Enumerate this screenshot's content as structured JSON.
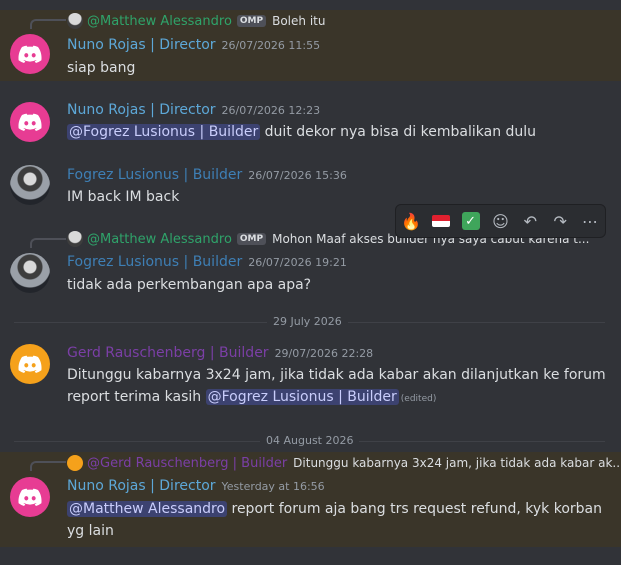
{
  "messages": [
    {
      "author": "Nuno Rojas | Director",
      "color": "#5da8d8",
      "time": "26/07/2026 11:55",
      "text": "siap bang",
      "reply": {
        "author": "@Matthew Alessandro",
        "color": "#2fa36a",
        "badge": "OMP",
        "text": "Boleh itu"
      }
    },
    {
      "author": "Nuno Rojas | Director",
      "color": "#5da8d8",
      "time": "26/07/2026 12:23",
      "mention": "@Fogrez Lusionus | Builder",
      "text": " duit dekor nya bisa di kembalikan dulu"
    },
    {
      "author": "Fogrez Lusionus | Builder",
      "color": "#3e7fb5",
      "time": "26/07/2026 15:36",
      "text": "IM back IM back"
    },
    {
      "author": "Fogrez Lusionus | Builder",
      "color": "#3e7fb5",
      "time": "26/07/2026 19:21",
      "text": "tidak ada perkembangan apa apa?",
      "reply": {
        "author": "@Matthew Alessandro",
        "color": "#2fa36a",
        "badge": "OMP",
        "text": "Mohon Maaf akses builder nya saya cabut karena t..."
      }
    },
    {
      "author": "Gerd Rauschenberg | Builder",
      "color": "#7b3fa6",
      "time": "29/07/2026 22:28",
      "line1": "Ditunggu kabarnya 3x24 jam, jika tidak ada kabar akan dilanjutkan ke forum",
      "line2": "report terima kasih ",
      "mention": "@Fogrez Lusionus | Builder",
      "edited": "(edited)"
    },
    {
      "author": "Nuno Rojas | Director",
      "color": "#5da8d8",
      "time": "Yesterday at 16:56",
      "mention": "@Matthew Alessandro",
      "text": " report forum aja bang trs request refund, kyk korban",
      "line2": "yg lain",
      "reply": {
        "author": "@Gerd Rauschenberg | Builder",
        "color": "#7b3fa6",
        "text": "Ditunggu kabarnya 3x24 jam, jika tidak ada kabar ak..."
      }
    }
  ],
  "dividers": [
    "29 July 2026",
    "04 August 2026"
  ],
  "toolbar": {
    "icons": [
      "fire-emoji",
      "indonesia-flag-emoji",
      "check-mark-emoji",
      "add-reaction-icon",
      "reply-icon",
      "forward-icon",
      "more-icon"
    ],
    "emojis": [
      "🔥",
      "🇮🇩",
      "✅",
      "☺",
      "↶",
      "↷",
      "⋯"
    ]
  }
}
